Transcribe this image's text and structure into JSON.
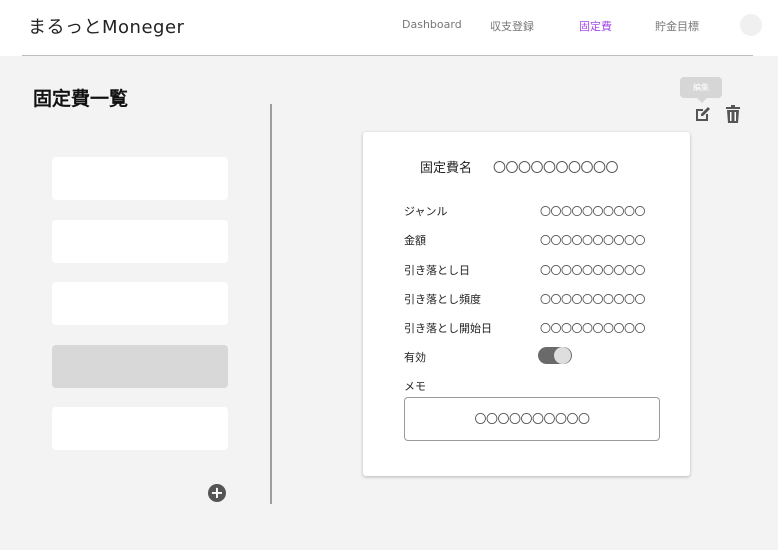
{
  "header": {
    "brand": "まるっとMoneger",
    "nav": [
      {
        "label": "Dashboard",
        "active": false
      },
      {
        "label": "収支登録",
        "active": false
      },
      {
        "label": "固定費",
        "active": true
      },
      {
        "label": "貯金目標",
        "active": false
      }
    ],
    "accent_color": "#a64be8"
  },
  "page": {
    "title": "固定費一覧"
  },
  "list": {
    "items": [
      {
        "selected": false
      },
      {
        "selected": false
      },
      {
        "selected": false
      },
      {
        "selected": true
      },
      {
        "selected": false
      }
    ],
    "add_icon": "plus-circle-icon"
  },
  "toolbar": {
    "tooltip": "編集",
    "edit_icon": "edit-icon",
    "delete_icon": "trash-icon"
  },
  "detail": {
    "name_label": "固定費名",
    "name_value": "〇〇〇〇〇〇〇〇〇〇",
    "fields": [
      {
        "label": "ジャンル",
        "value": "〇〇〇〇〇〇〇〇〇〇"
      },
      {
        "label": "金額",
        "value": "〇〇〇〇〇〇〇〇〇〇"
      },
      {
        "label": "引き落とし日",
        "value": "〇〇〇〇〇〇〇〇〇〇"
      },
      {
        "label": "引き落とし頻度",
        "value": "〇〇〇〇〇〇〇〇〇〇"
      },
      {
        "label": "引き落とし開始日",
        "value": "〇〇〇〇〇〇〇〇〇〇"
      }
    ],
    "active_label": "有効",
    "active_on": true,
    "memo_label": "メモ",
    "memo_value": "〇〇〇〇〇〇〇〇〇〇"
  }
}
